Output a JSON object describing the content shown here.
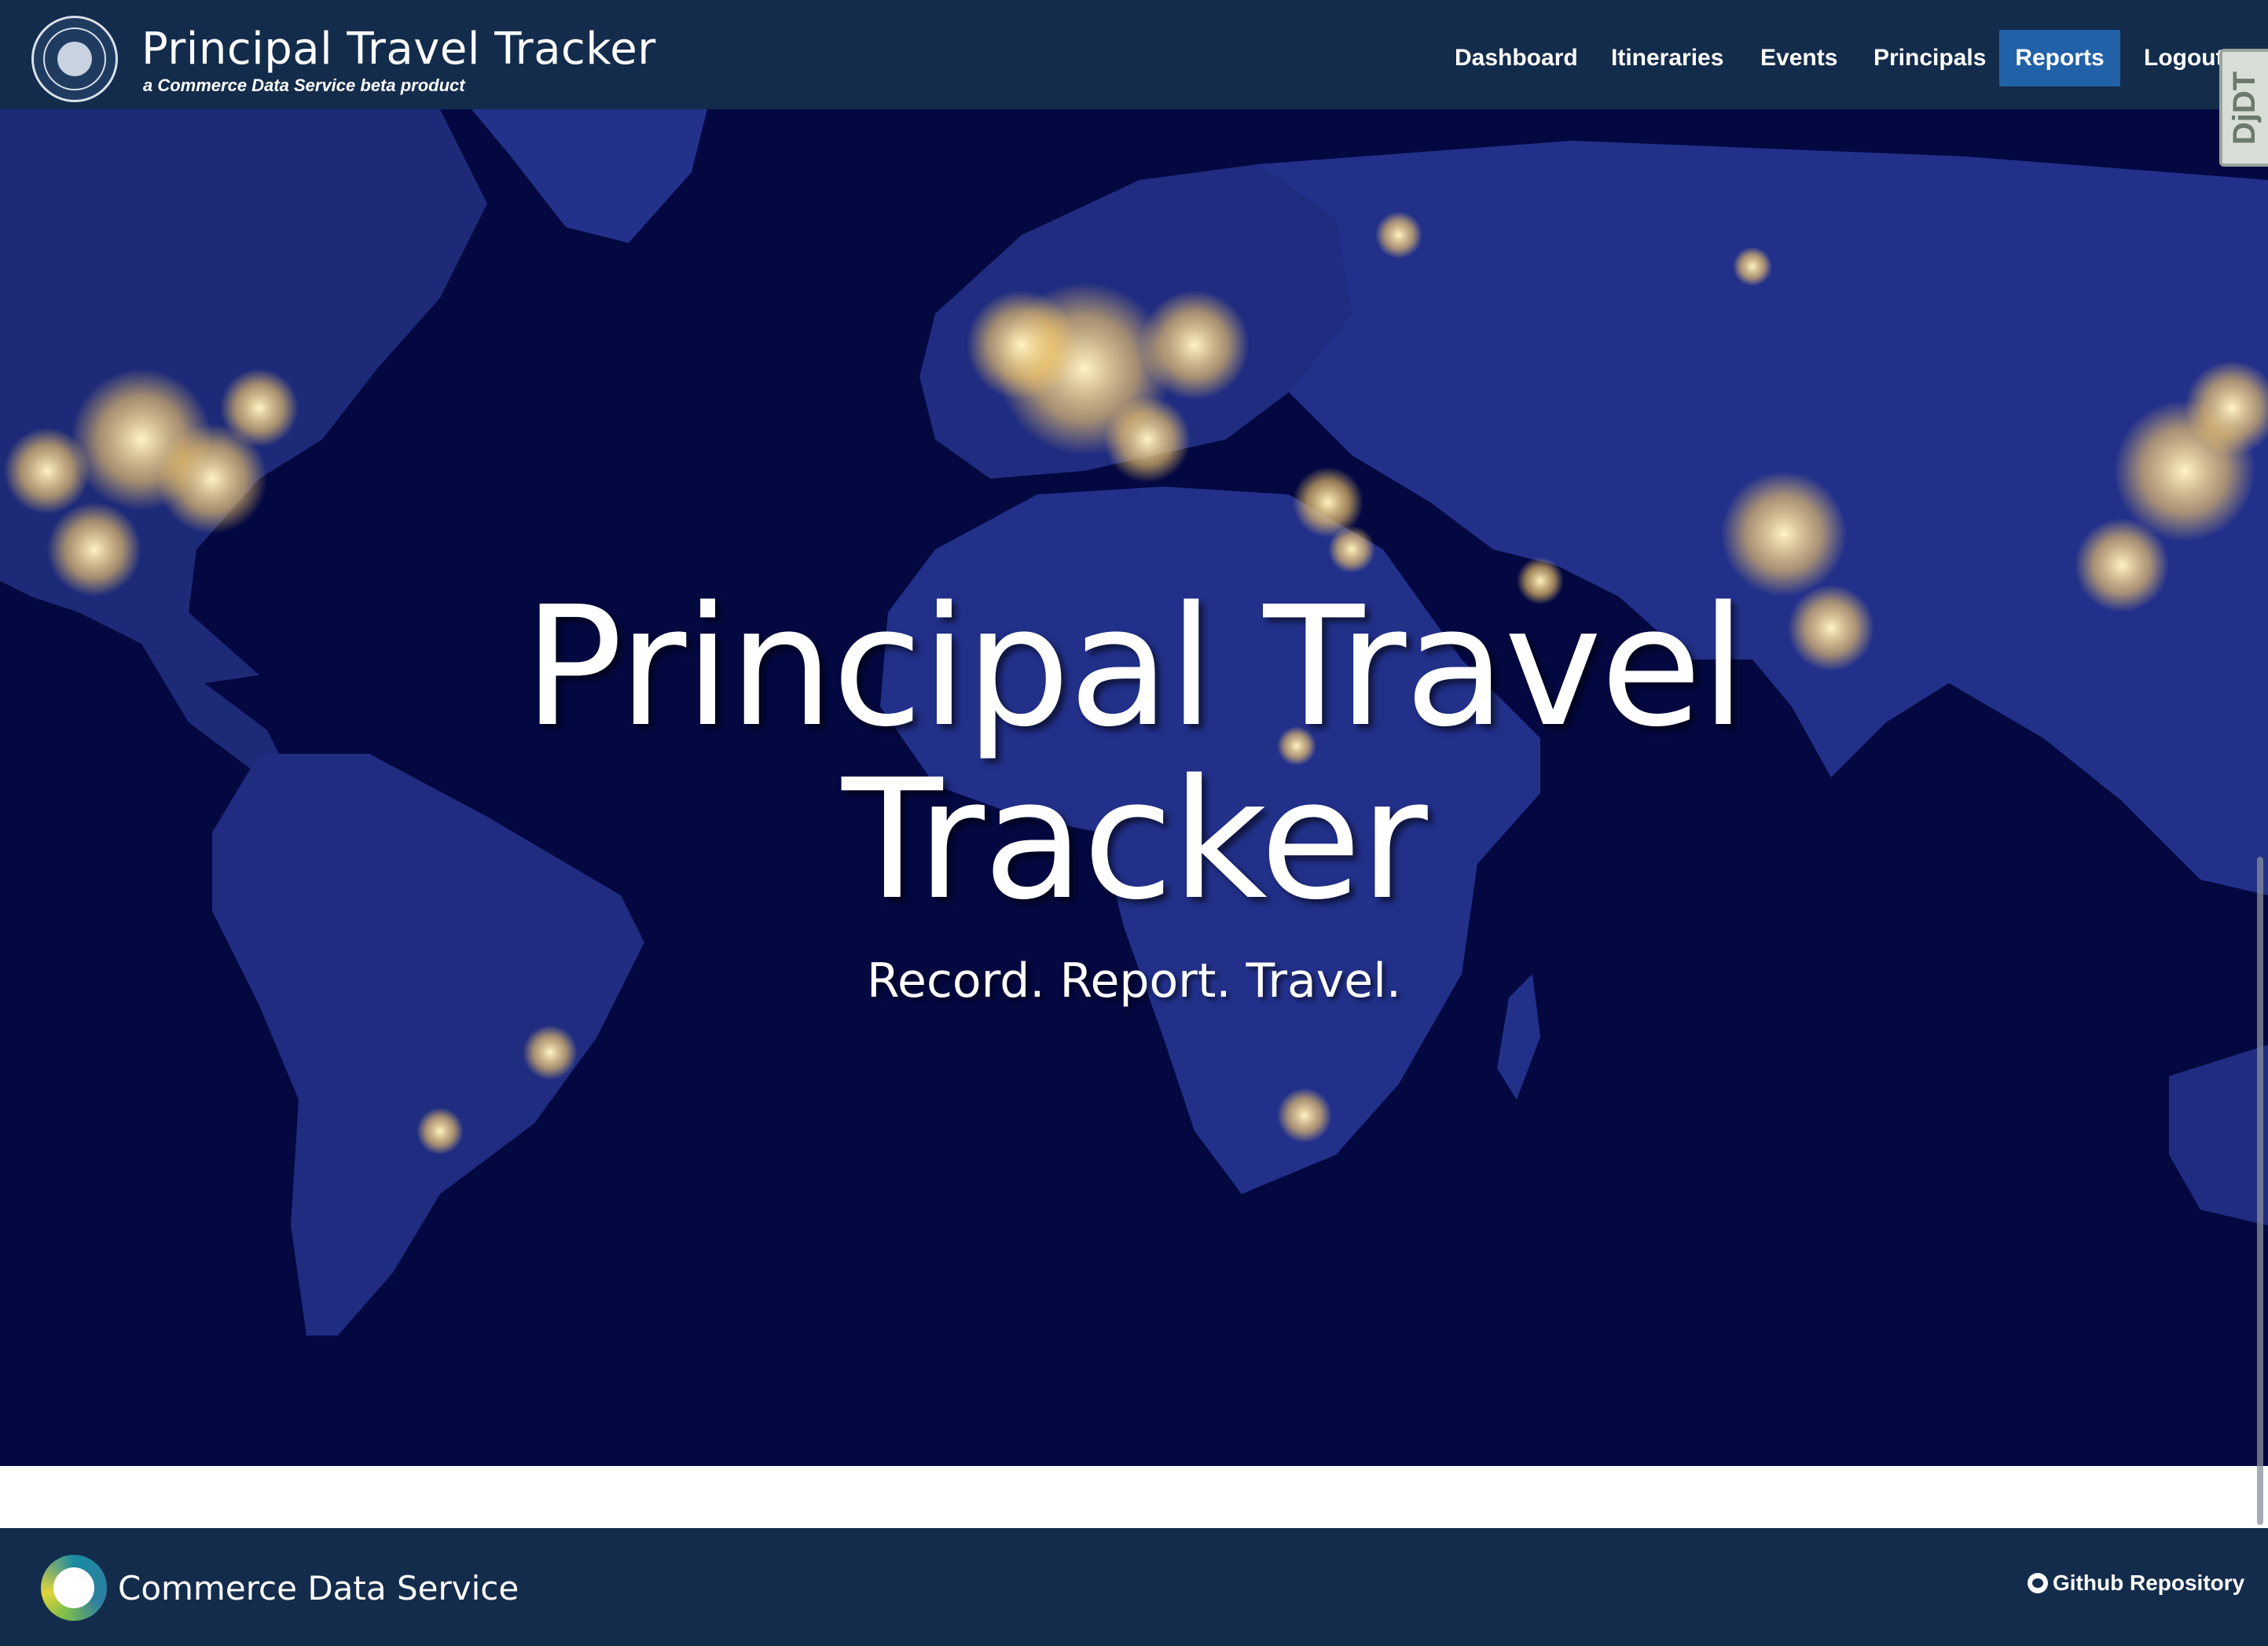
{
  "navbar": {
    "brand_title": "Principal Travel Tracker",
    "brand_subtitle": "a Commerce Data Service beta product",
    "seal_icon": "department-of-commerce-seal",
    "items": [
      {
        "label": "Dashboard",
        "active": false
      },
      {
        "label": "Itineraries",
        "active": false
      },
      {
        "label": "Events",
        "active": false
      },
      {
        "label": "Principals",
        "active": false
      },
      {
        "label": "Reports",
        "active": true
      },
      {
        "label": "Logout",
        "active": false
      }
    ],
    "colors": {
      "background": "#142c4b",
      "active": "#2161a8"
    }
  },
  "debug_toolbar": {
    "label": "DjDT"
  },
  "hero": {
    "title_line1": "Principal Travel",
    "title_line2": "Tracker",
    "tagline": "Record. Report. Travel.",
    "background_image": "world-map-at-night",
    "colors": {
      "ocean": "#030841",
      "land": "#1f2b7a",
      "city_lights": "#ffd98a"
    }
  },
  "footer": {
    "brand": "Commerce Data Service",
    "logo_icon": "commerce-data-service-logo",
    "github_icon": "github-icon",
    "github_label": "Github Repository",
    "colors": {
      "background": "#142c4b"
    }
  }
}
